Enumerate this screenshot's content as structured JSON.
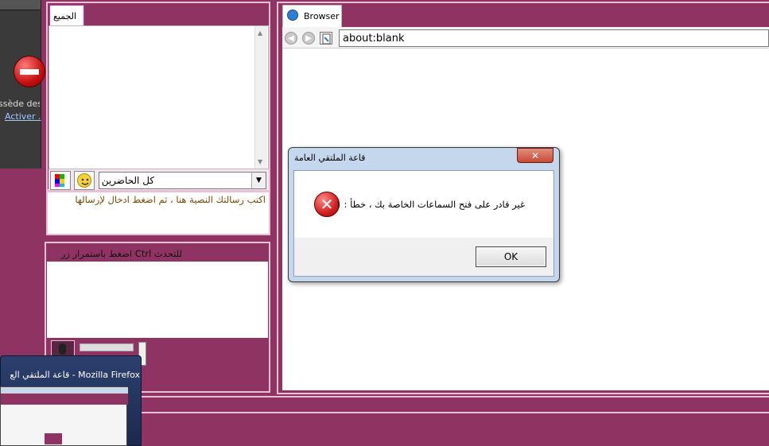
{
  "desktop": {
    "text_line1": "ssède des",
    "text_line2": "Activer ."
  },
  "chat": {
    "tab_label": "الجميع",
    "recipient_selected": "كل الحاضرين",
    "message_placeholder": "اكتب رسالتك النصية هنا ، ثم اضغط ادخال لإرسالها"
  },
  "voice": {
    "hint": "اضغط باستمرار زر Ctrl للتحدث"
  },
  "browser": {
    "tab_label": "Browser",
    "url": "about:blank"
  },
  "dialog": {
    "title": "قاعة الملتقي العامة",
    "message": "غير قادر على فتح السماعات الخاصة بك ، خطأ : ١",
    "ok_label": "OK",
    "close_glyph": "✕"
  },
  "taskbar_thumb": {
    "title": "قاعة الملتقي الع - Mozilla Firefox"
  },
  "icons": {
    "error": "✕",
    "back": "◀",
    "forward": "▶",
    "dropdown": "▼",
    "scroll_up": "▲",
    "scroll_down": "▼"
  },
  "colors": {
    "background": "#8f3462",
    "panel_border": "#e9c0d6",
    "message_text": "#7a4a00"
  }
}
